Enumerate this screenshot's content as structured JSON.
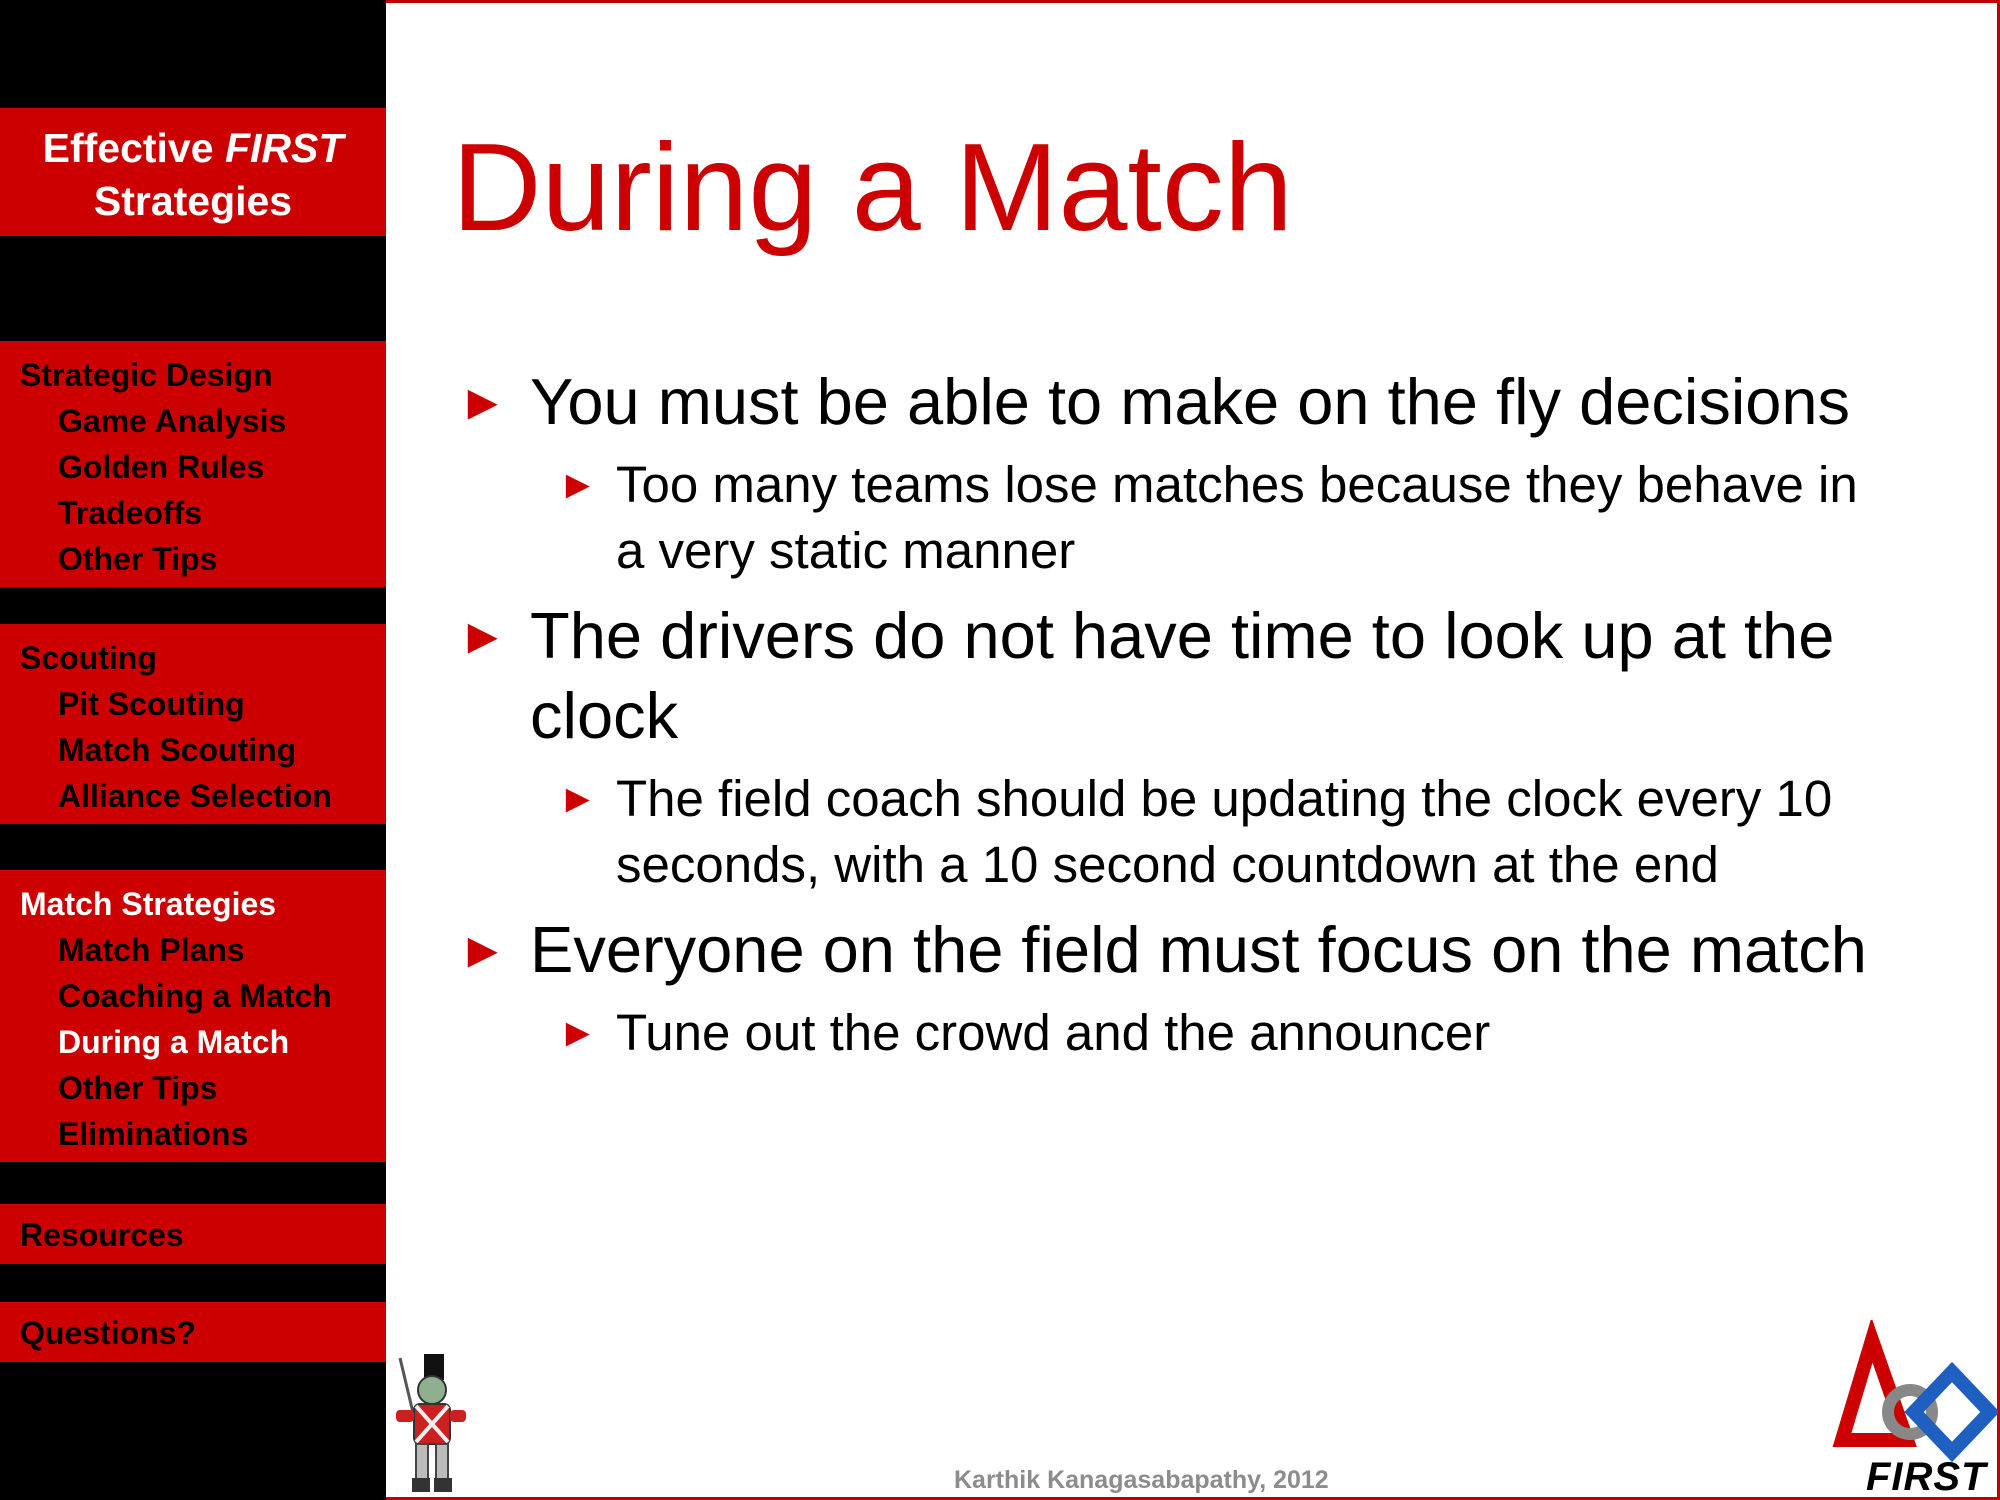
{
  "sidebar": {
    "title_prefix": "Effective ",
    "title_em": "FIRST",
    "title_suffix": "Strategies",
    "sections": [
      {
        "heading": "Strategic Design",
        "items": [
          "Game Analysis",
          "Golden Rules",
          "Tradeoffs",
          "Other Tips"
        ]
      },
      {
        "heading": "Scouting",
        "items": [
          "Pit Scouting",
          "Match Scouting",
          "Alliance Selection"
        ]
      },
      {
        "heading": "Match Strategies",
        "items": [
          "Match Plans",
          "Coaching a Match",
          "During a Match",
          "Other Tips",
          "Eliminations"
        ]
      },
      {
        "heading": "Resources",
        "items": []
      },
      {
        "heading": "Questions?",
        "items": []
      }
    ]
  },
  "slide": {
    "title": "During a Match",
    "bullets": [
      {
        "text": "You must be able to make on the fly decisions",
        "sub": [
          "Too many teams lose matches because they behave in a very static manner"
        ]
      },
      {
        "text": "The drivers do not have time to look up at the clock",
        "sub": [
          "The field coach should be updating the clock every 10 seconds, with a 10 second countdown at the end"
        ]
      },
      {
        "text": "Everyone on the field must focus on the match",
        "sub": [
          "Tune out the crowd and the announcer"
        ]
      }
    ],
    "bullet_glyph": "►"
  },
  "footer": {
    "author": "Karthik Kanagasabapathy, 2012",
    "logo_text": "FIRST",
    "logo_icon": "first-logo-icon",
    "mascot_icon": "robot-mascot-icon"
  },
  "colors": {
    "accent_red": "#cc0000",
    "sidebar_black": "#000000",
    "footer_gray": "#8c8c8c"
  }
}
